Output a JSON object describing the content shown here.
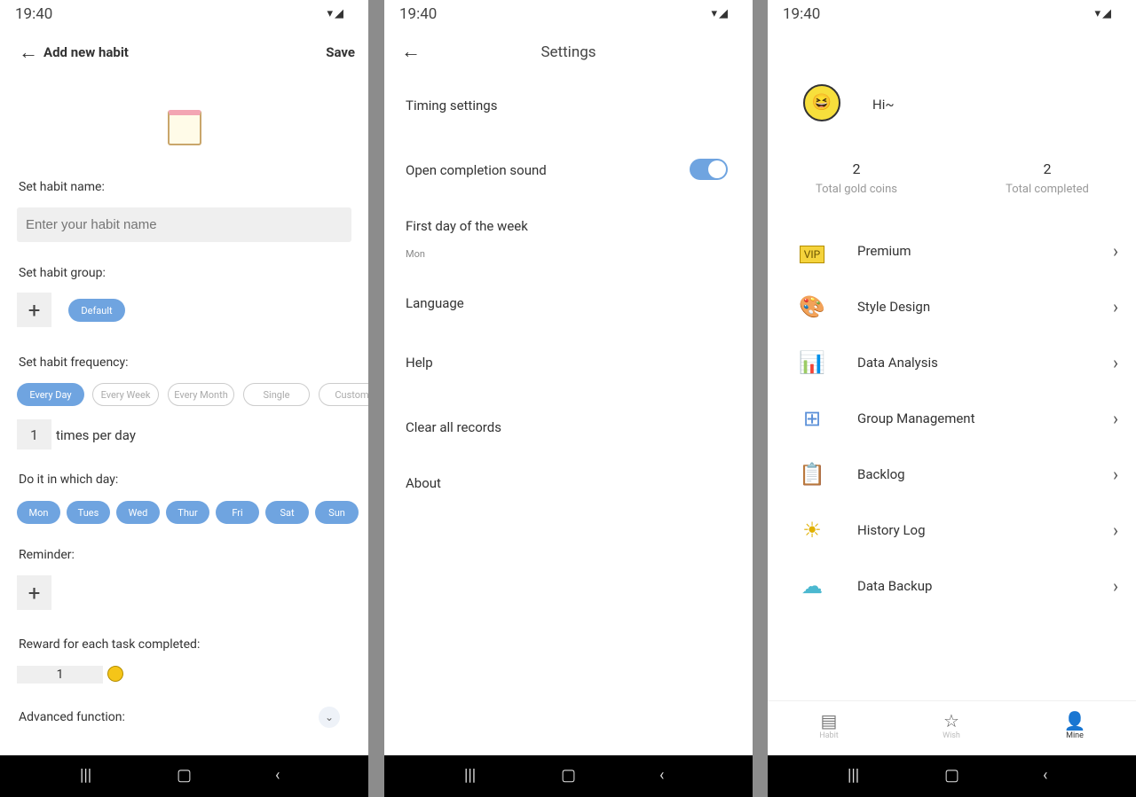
{
  "status_time": "19:40",
  "add_habit": {
    "title": "Add new habit",
    "save": "Save",
    "name_label": "Set habit name:",
    "name_placeholder": "Enter your habit name",
    "group_label": "Set habit group:",
    "group_default": "Default",
    "freq_label": "Set habit frequency:",
    "freq_options": [
      "Every Day",
      "Every Week",
      "Every Month",
      "Single",
      "Custom"
    ],
    "times_value": "1",
    "times_suffix": "times per day",
    "day_label": "Do it in which day:",
    "days": [
      "Mon",
      "Tues",
      "Wed",
      "Thur",
      "Fri",
      "Sat",
      "Sun"
    ],
    "reminder_label": "Reminder:",
    "reward_label": "Reward for each task completed:",
    "reward_value": "1",
    "advanced_label": "Advanced function:"
  },
  "settings": {
    "title": "Settings",
    "items": [
      "Timing settings",
      "Open completion sound",
      "First day of the week",
      "Language",
      "Help",
      "Clear all records",
      "About"
    ],
    "first_day_value": "Mon",
    "sound_on": true,
    "accent": "#6fa4e0"
  },
  "mine": {
    "greeting": "Hi~",
    "coins": "2",
    "coins_label": "Total gold coins",
    "completed": "2",
    "completed_label": "Total completed",
    "vip_badge": "VIP",
    "menu": [
      {
        "label": "Premium",
        "icon": "vip-icon"
      },
      {
        "label": "Style Design",
        "icon": "palette-icon"
      },
      {
        "label": "Data Analysis",
        "icon": "bar-chart-icon"
      },
      {
        "label": "Group Management",
        "icon": "hierarchy-icon"
      },
      {
        "label": "Backlog",
        "icon": "clipboard-icon"
      },
      {
        "label": "History Log",
        "icon": "sun-icon"
      },
      {
        "label": "Data Backup",
        "icon": "cloud-icon"
      }
    ],
    "tabs": [
      "Habit",
      "Wish",
      "Mine"
    ]
  }
}
